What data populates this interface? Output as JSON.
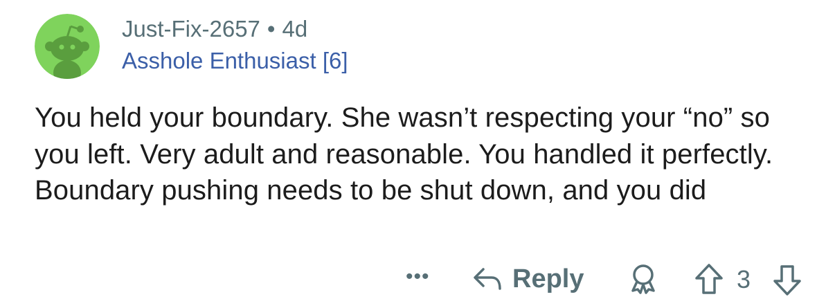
{
  "comment": {
    "author": "Just-Fix-2657",
    "separator": "•",
    "age": "4d",
    "flair": "Asshole Enthusiast [6]",
    "body": "You held your boundary. She wasn’t respecting your “no” so you left. Very adult and reasonable. You handled it perfectly. Boundary pushing needs to be shut down, and you did"
  },
  "actions": {
    "more_label": "•••",
    "reply_label": "Reply",
    "score": "3"
  },
  "icons": {
    "avatar": "reddit-snoo-avatar",
    "reply": "reply-arrow-icon",
    "award": "award-icon",
    "upvote": "upvote-arrow-icon",
    "downvote": "downvote-arrow-icon"
  },
  "colors": {
    "meta": "#576f76",
    "flair": "#3b5fa8",
    "avatar_bg": "#7fd35c",
    "text": "#1c1c1c"
  }
}
